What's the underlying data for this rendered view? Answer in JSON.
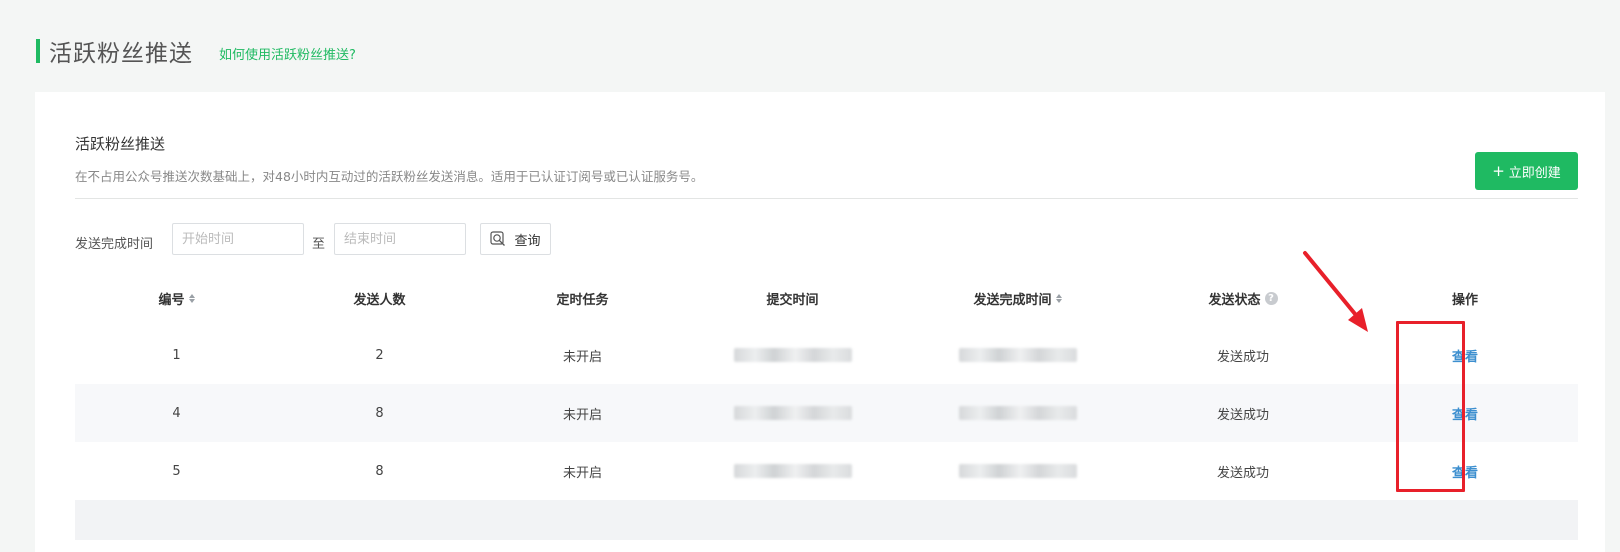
{
  "header": {
    "title": "活跃粉丝推送",
    "help_link": "如何使用活跃粉丝推送?"
  },
  "section": {
    "title": "活跃粉丝推送",
    "description": "在不占用公众号推送次数基础上，对48小时内互动过的活跃粉丝发送消息。适用于已认证订阅号或已认证服务号。",
    "create_button": "立即创建"
  },
  "filter": {
    "label": "发送完成时间",
    "start_placeholder": "开始时间",
    "separator": "至",
    "end_placeholder": "结束时间",
    "search_button": "查询"
  },
  "table": {
    "columns": [
      "编号",
      "发送人数",
      "定时任务",
      "提交时间",
      "发送完成时间",
      "发送状态",
      "操作"
    ],
    "rows": [
      {
        "id": "1",
        "count": "2",
        "scheduled": "未开启",
        "status": "发送成功",
        "action": "查看"
      },
      {
        "id": "4",
        "count": "8",
        "scheduled": "未开启",
        "status": "发送成功",
        "action": "查看"
      },
      {
        "id": "5",
        "count": "8",
        "scheduled": "未开启",
        "status": "发送成功",
        "action": "查看"
      }
    ]
  },
  "icons": {
    "create": "plus-icon",
    "search": "search-icon",
    "sort": "sort-icon",
    "help": "question-icon"
  },
  "colors": {
    "brand_green": "#1fba62",
    "link_blue": "#3d8fcf",
    "annotation_red": "#e8202a"
  }
}
